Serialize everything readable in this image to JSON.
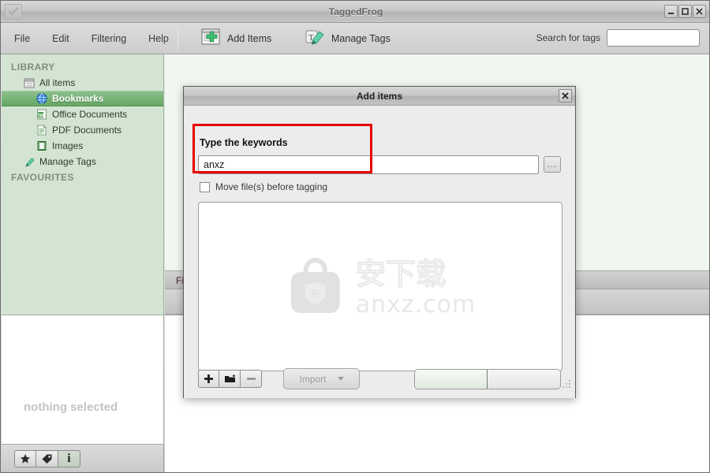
{
  "window": {
    "title": "TaggedFrog",
    "app_icon": "checkmark-icon",
    "controls": {
      "minimize": "minimize-icon",
      "maximize": "maximize-icon",
      "close": "close-icon"
    }
  },
  "menubar": {
    "items": [
      {
        "label": "File"
      },
      {
        "label": "Edit"
      },
      {
        "label": "Filtering"
      },
      {
        "label": "Help"
      }
    ]
  },
  "toolbar": {
    "add_items": {
      "label": "Add Items",
      "icon": "add-items-icon"
    },
    "manage_tags": {
      "label": "Manage Tags",
      "icon": "pencil-tag-icon"
    },
    "search": {
      "label": "Search for tags",
      "value": "",
      "placeholder": ""
    }
  },
  "sidebar": {
    "sections": [
      {
        "title": "LIBRARY",
        "items": [
          {
            "label": "All items",
            "icon": "all-items-icon",
            "indent": 1,
            "selected": false
          },
          {
            "label": "Bookmarks",
            "icon": "globe-icon",
            "indent": 2,
            "selected": true
          },
          {
            "label": "Office Documents",
            "icon": "word-doc-icon",
            "indent": 2,
            "selected": false
          },
          {
            "label": "PDF Documents",
            "icon": "pdf-doc-icon",
            "indent": 2,
            "selected": false
          },
          {
            "label": "Images",
            "icon": "film-icon",
            "indent": 2,
            "selected": false
          },
          {
            "label": "Manage Tags",
            "icon": "pencil-tag-icon",
            "indent": 1,
            "selected": false
          }
        ]
      },
      {
        "title": "FAVOURITES",
        "items": []
      }
    ]
  },
  "info_panel": {
    "empty_text": "nothing selected"
  },
  "statusbar": {
    "buttons": [
      {
        "name": "favourites-button",
        "icon": "star-icon",
        "active": false
      },
      {
        "name": "tags-button",
        "icon": "tag-icon",
        "active": false
      },
      {
        "name": "info-button",
        "icon": "info-icon",
        "active": true
      }
    ]
  },
  "main": {
    "tab_label": "Fil"
  },
  "dialog": {
    "title": "Add items",
    "close_icon": "close-icon",
    "keywords": {
      "label": "Type the keywords",
      "value": "anxz",
      "placeholder": "",
      "browse_label": "...",
      "highlighted": true,
      "highlight_color": "#e60000"
    },
    "move_files": {
      "label": "Move file(s) before tagging",
      "checked": false
    },
    "filelist": {
      "items": [],
      "watermark": {
        "text_cn": "安下载",
        "url": "anxz.com",
        "icon": "shield-bag-icon"
      }
    },
    "actions": {
      "add": {
        "name": "add-file-button",
        "icon": "plus-icon"
      },
      "add_folder": {
        "name": "add-folder-button",
        "icon": "folder-icon"
      },
      "remove": {
        "name": "remove-file-button",
        "icon": "minus-icon"
      },
      "import": {
        "label": "Import",
        "enabled": false,
        "icon": "caret-down-icon"
      },
      "confirm": {
        "label": ""
      },
      "cancel": {
        "label": ""
      }
    }
  }
}
